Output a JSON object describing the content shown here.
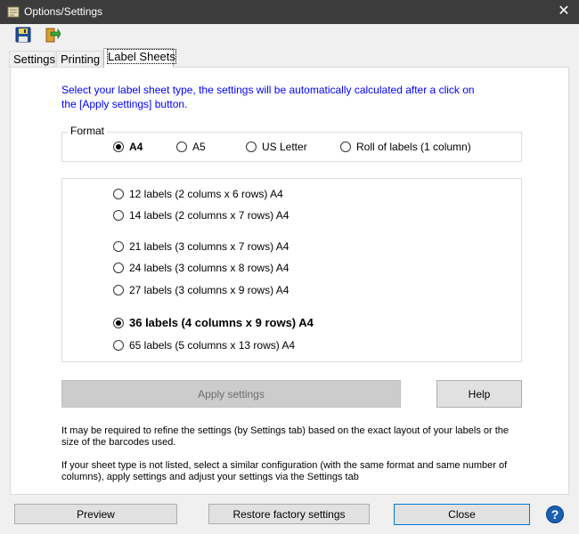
{
  "window": {
    "title": "Options/Settings",
    "close_symbol": "✕",
    "app_icon": "settings-app-icon"
  },
  "toolbar": {
    "buttons": [
      {
        "icon": "floppy-disk-save-icon"
      },
      {
        "icon": "import-arrow-icon"
      }
    ]
  },
  "tabs": [
    {
      "label": "Settings",
      "active": false
    },
    {
      "label": "Printing",
      "active": false
    },
    {
      "label": "Label Sheets",
      "active": true
    }
  ],
  "label_sheets": {
    "intro": "Select your label sheet type, the settings will be automatically calculated after a click on the [Apply settings] button.",
    "format": {
      "legend": "Format",
      "options": [
        {
          "label": "A4",
          "checked": true
        },
        {
          "label": "A5",
          "checked": false
        },
        {
          "label": "US Letter",
          "checked": false
        },
        {
          "label": "Roll of labels (1 column)",
          "checked": false
        }
      ]
    },
    "sheets": [
      {
        "label": "12 labels (2 colums x 6 rows) A4",
        "checked": false
      },
      {
        "label": "14 labels (2 columns x 7 rows) A4",
        "checked": false
      },
      {
        "label": "21 labels (3 columns x 7 rows) A4",
        "checked": false
      },
      {
        "label": "24 labels (3 columns x 8 rows) A4",
        "checked": false
      },
      {
        "label": "27 labels (3 columns x 9 rows) A4",
        "checked": false
      },
      {
        "label": "36 labels (4 columns x 9 rows) A4",
        "checked": true
      },
      {
        "label": "65 labels (5 columns x 13 rows) A4",
        "checked": false
      }
    ],
    "apply_label": "Apply settings",
    "help_label": "Help",
    "note1": "It may be required to refine the settings (by Settings tab) based on the exact layout of your labels or the size of the barcodes used.",
    "note2": "If your sheet type is not listed, select a similar configuration (with the same format and same number of columns), apply settings and adjust your settings via the Settings tab"
  },
  "footer": {
    "preview_label": "Preview",
    "restore_label": "Restore factory settings",
    "close_label": "Close",
    "help_symbol": "?"
  },
  "colors": {
    "titlebar": "#3c3c3c",
    "intro_text": "#0000ff",
    "help_icon": "#1a5fb4"
  }
}
